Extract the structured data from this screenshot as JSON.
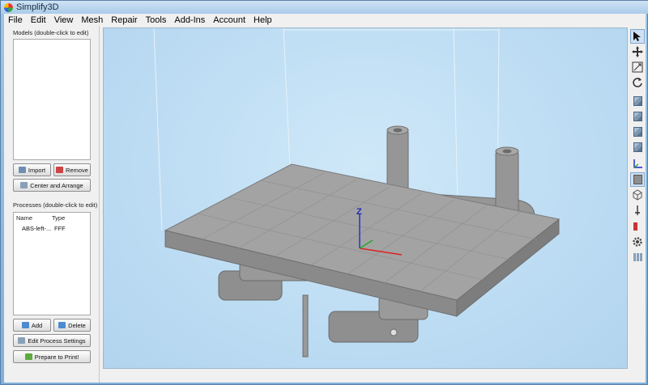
{
  "window": {
    "title": "Simplify3D"
  },
  "menu": [
    "File",
    "Edit",
    "View",
    "Mesh",
    "Repair",
    "Tools",
    "Add-Ins",
    "Account",
    "Help"
  ],
  "models": {
    "label": "Models (double-click to edit)",
    "import_label": "Import",
    "remove_label": "Remove",
    "center_label": "Center and Arrange"
  },
  "processes": {
    "label": "Processes (double-click to edit)",
    "columns": [
      "Name",
      "Type"
    ],
    "rows": [
      {
        "name": "ABS-left-...",
        "type": "FFF"
      }
    ],
    "add_label": "Add",
    "delete_label": "Delete",
    "edit_label": "Edit Process Settings",
    "prepare_label": "Prepare to Print!"
  },
  "viewport": {
    "axis_label": "Z"
  },
  "toolbar_icons": [
    "select-arrow-icon",
    "move-icon",
    "scale-icon",
    "rotate-icon",
    "view-default-icon",
    "view-front-icon",
    "view-top-icon",
    "view-side-icon",
    "show-axes-icon",
    "solid-view-icon",
    "wireframe-icon",
    "show-nozzle-icon",
    "cross-section-icon",
    "settings-gear-icon",
    "show-build-volume-icon"
  ],
  "colors": {
    "accent": "#0f6fb0",
    "viewport_bg": "#bcdcf3",
    "model_gray": "#8f8f8f"
  }
}
